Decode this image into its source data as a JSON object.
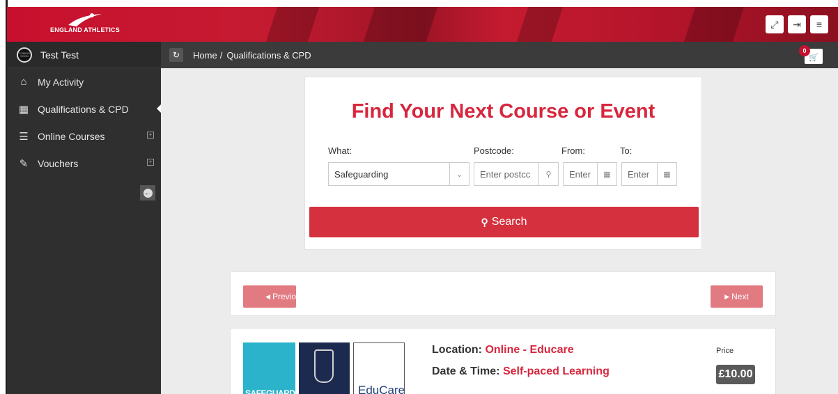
{
  "header": {
    "logo_text": "ENGLAND ATHLETICS",
    "buttons": [
      {
        "name": "fullscreen-icon",
        "glyph": "⤢"
      },
      {
        "name": "logout-icon",
        "glyph": "⇥"
      },
      {
        "name": "menu-icon",
        "glyph": "≡"
      }
    ]
  },
  "sidebar": {
    "user_name": "Test Test",
    "avatar_text": "COMING SOON",
    "items": [
      {
        "label": "My Activity",
        "icon": "home-icon",
        "glyph": "⌂",
        "expandable": false,
        "active": false
      },
      {
        "label": "Qualifications & CPD",
        "icon": "calendar-icon",
        "glyph": "▦",
        "expandable": false,
        "active": true
      },
      {
        "label": "Online Courses",
        "icon": "list-icon",
        "glyph": "☰",
        "expandable": true,
        "active": false
      },
      {
        "label": "Vouchers",
        "icon": "tag-icon",
        "glyph": "✎",
        "expandable": true,
        "active": false
      }
    ]
  },
  "breadcrumb": {
    "home": "Home",
    "separator": "/",
    "current": "Qualifications & CPD"
  },
  "cart": {
    "count": "0"
  },
  "search": {
    "title": "Find Your Next Course or Event",
    "what_label": "What:",
    "what_value": "Safeguarding",
    "postcode_label": "Postcode:",
    "postcode_placeholder": "Enter postcc",
    "from_label": "From:",
    "from_placeholder": "Enter",
    "to_label": "To:",
    "to_placeholder": "Enter",
    "button_label": "Search"
  },
  "pager": {
    "prev_label": "Previo",
    "next_label": "Next"
  },
  "course": {
    "images": [
      "SAFEGUARDING",
      "",
      "EduCare"
    ],
    "location_label": "Location:",
    "location_value": "Online - Educare",
    "datetime_label": "Date & Time:",
    "datetime_value": "Self-paced Learning",
    "price_label": "Price",
    "price_value": "£10.00"
  },
  "colors": {
    "brand_red": "#c8102e",
    "title_red": "#d7263d",
    "search_button": "#d5303e",
    "pager_button": "#e27a82",
    "sidebar_bg": "#2f2f2f"
  }
}
